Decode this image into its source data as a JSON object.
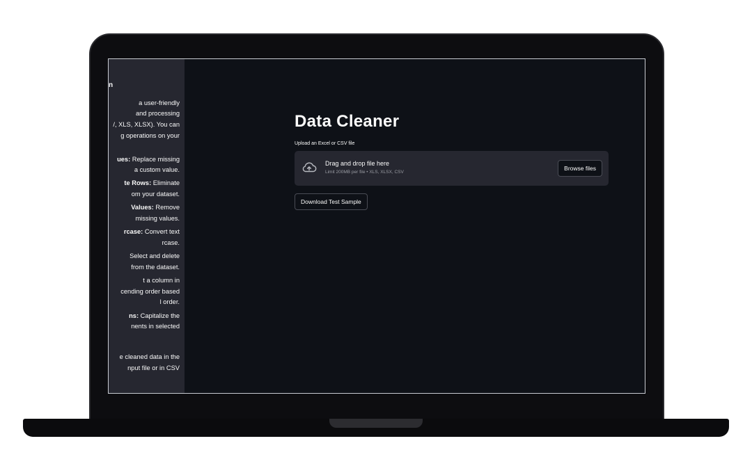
{
  "sidebar": {
    "heading": "n",
    "intro_lines": [
      "a user-friendly",
      " and processing",
      "/, XLS, XLSX). You can",
      "g operations on your"
    ],
    "items": [
      {
        "bold": "ues:",
        "text": " Replace missing",
        "line2": " a custom value."
      },
      {
        "bold": "te Rows:",
        "text": " Eliminate",
        "line2": "om your dataset."
      },
      {
        "bold": "Values:",
        "text": " Remove",
        "line2": "missing values."
      },
      {
        "bold": "rcase:",
        "text": " Convert text",
        "line2": "rcase."
      },
      {
        "bold": "",
        "text": " Select and delete",
        "line2": " from the dataset."
      },
      {
        "bold": "",
        "text": "t a column in",
        "line2": "cending order based",
        "line3": "l order."
      },
      {
        "bold": "ns:",
        "text": " Capitalize the",
        "line2": "nents in selected"
      }
    ],
    "outro_lines": [
      "e cleaned data in the",
      "nput file or in CSV"
    ]
  },
  "main": {
    "title": "Data Cleaner",
    "uploader_label": "Upload an Excel or CSV file",
    "dropzone_main": "Drag and drop file here",
    "dropzone_sub": "Limit 200MB per file • XLS, XLSX, CSV",
    "browse_label": "Browse files",
    "download_label": "Download Test Sample"
  },
  "theme": {
    "background": "#0e1117",
    "sidebar_bg": "#262730",
    "text": "#fafafa"
  }
}
